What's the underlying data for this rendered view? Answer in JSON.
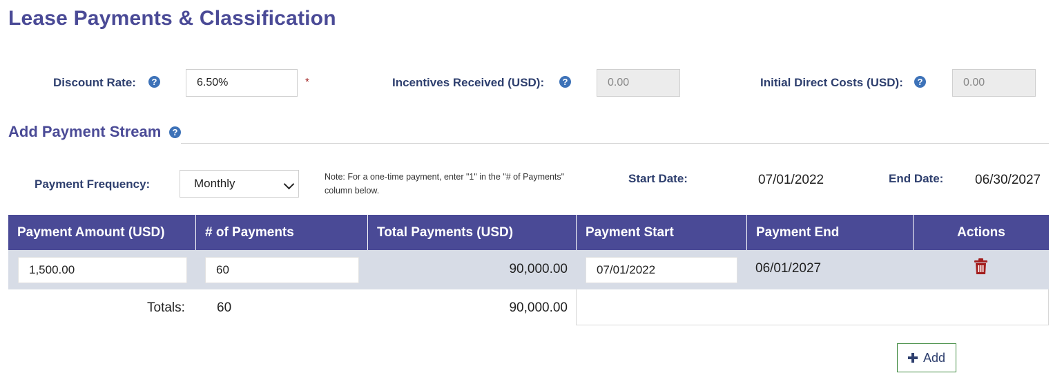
{
  "page": {
    "title": "Lease Payments & Classification"
  },
  "rates": {
    "discount_label": "Discount Rate:",
    "discount_value": "6.50%",
    "required_mark": "*",
    "incentives_label": "Incentives Received (USD):",
    "incentives_value": "0.00",
    "idc_label": "Initial Direct Costs (USD):",
    "idc_value": "0.00",
    "help_glyph": "?"
  },
  "stream": {
    "title": "Add Payment Stream",
    "frequency_label": "Payment Frequency:",
    "frequency_value": "Monthly",
    "note_line1": "Note: For a one-time payment, enter \"1\" in the \"# of Payments\"",
    "note_line2": "column below.",
    "start_label": "Start Date:",
    "start_value": "07/01/2022",
    "end_label": "End Date:",
    "end_value": "06/30/2027"
  },
  "table": {
    "headers": [
      "Payment Amount (USD)",
      "# of Payments",
      "Total Payments (USD)",
      "Payment Start",
      "Payment End",
      "Actions"
    ],
    "rows": [
      {
        "amount": "1,500.00",
        "count": "60",
        "total": "90,000.00",
        "start": "07/01/2022",
        "end": "06/01/2027",
        "action_icon": "trash-icon"
      }
    ],
    "totals_label": "Totals:",
    "totals_count": "60",
    "totals_total": "90,000.00"
  },
  "actions": {
    "add_label": "Add",
    "add_icon": "plus-icon"
  },
  "colors": {
    "header_bg": "#4a4a96",
    "row_bg": "#d7dce6",
    "delete": "#a31d1d",
    "add_border": "#3f8a3f"
  }
}
